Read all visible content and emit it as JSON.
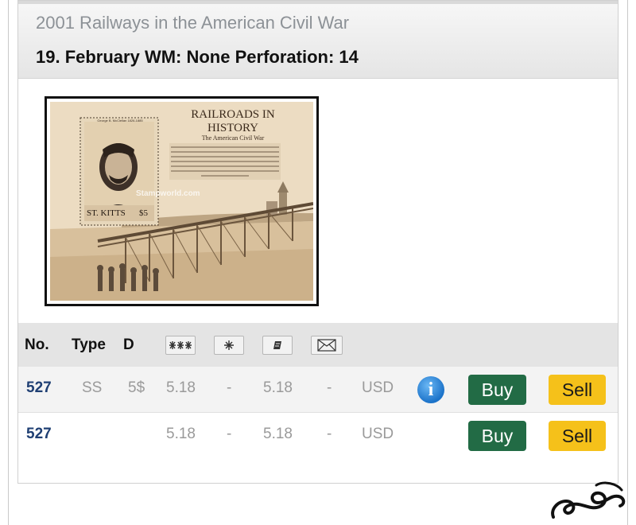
{
  "issue": {
    "title": "2001 Railways in the American Civil War",
    "details": "19. February WM: None Perforation: 14"
  },
  "stamp_image": {
    "heading_line1": "RAILROADS IN",
    "heading_line2": "HISTORY",
    "subheading": "The American Civil War",
    "portrait_caption": "George B. McClellan 1826-1885",
    "country": "ST. KITTS",
    "denomination": "$5",
    "watermark": "Stampworld.com"
  },
  "table": {
    "headers": {
      "no": "No.",
      "type": "Type",
      "d": "D"
    },
    "condition_icons": [
      "mint-never-hinged-icon",
      "mint-hinged-icon",
      "used-icon",
      "cover-icon"
    ],
    "rows": [
      {
        "no": "527",
        "type": "SS",
        "d": "5$",
        "v1": "5.18",
        "v2": "-",
        "v3": "5.18",
        "v4": "-",
        "currency": "USD",
        "has_info": true,
        "buy": "Buy",
        "sell": "Sell"
      },
      {
        "no": "527",
        "type": "",
        "d": "",
        "v1": "5.18",
        "v2": "-",
        "v3": "5.18",
        "v4": "-",
        "currency": "USD",
        "has_info": false,
        "buy": "Buy",
        "sell": "Sell"
      }
    ],
    "info_glyph": "i"
  },
  "colors": {
    "buy": "#226b45",
    "sell": "#f5c11a",
    "number_link": "#1f3f73",
    "info": "#1c73c9"
  }
}
